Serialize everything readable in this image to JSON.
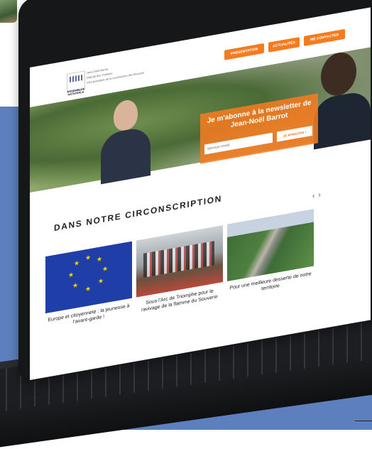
{
  "site": {
    "logo_text": "ASSEMBLÉE NATIONALE",
    "deputy_name": "Jean-Noël Barrot",
    "deputy_role": "Député des Yvelines",
    "deputy_subtitle": "Vice-président de la commission des finances"
  },
  "nav": {
    "items": [
      "PRÉSENTATION",
      "ACTUALITÉS",
      "ME CONTACTER"
    ]
  },
  "newsletter": {
    "title": "Je m'abonne à la newsletter de Jean-Noël Barrot",
    "placeholder": "adresse email",
    "button_label": "JE M'INSCRIS !"
  },
  "section": {
    "title": "DANS NOTRE CIRCONSCRIPTION",
    "prev_arrow": "‹",
    "next_arrow": "›"
  },
  "cards": [
    {
      "caption": "Europe et citoyenneté : la jeunesse à l'avant-garde !"
    },
    {
      "caption": "Sous l'Arc de Triomphe pour le ravivage de la flamme du Souvenir"
    },
    {
      "caption": "Pour une meilleure desserte de notre territoire"
    }
  ],
  "colors": {
    "accent": "#f47b20",
    "background_panel": "#5d7fbe"
  }
}
